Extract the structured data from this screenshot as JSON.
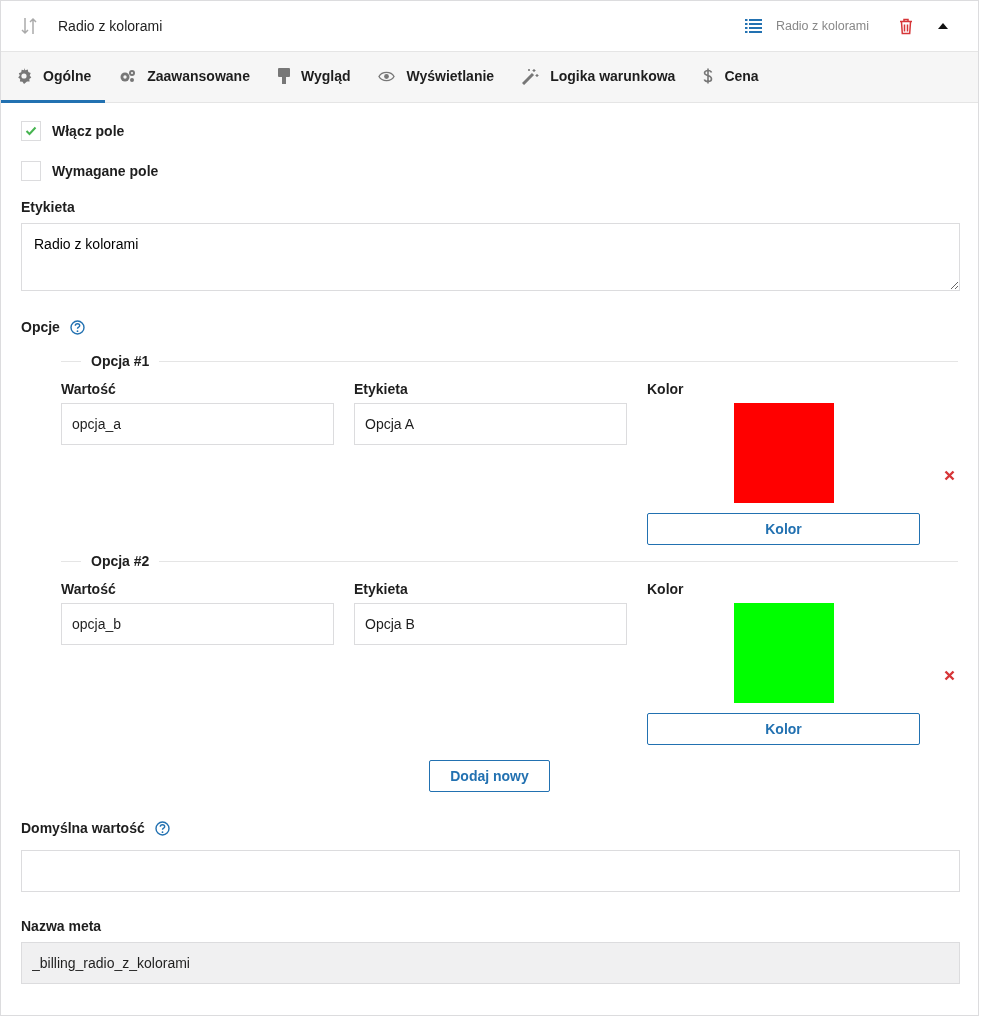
{
  "header": {
    "title": "Radio z kolorami",
    "type_label": "Radio z kolorami",
    "expanded": true
  },
  "tabs": [
    {
      "label": "Ogólne",
      "selected": true
    },
    {
      "label": "Zaawansowane",
      "selected": false
    },
    {
      "label": "Wygląd",
      "selected": false
    },
    {
      "label": "Wyświetlanie",
      "selected": false
    },
    {
      "label": "Logika warunkowa",
      "selected": false
    },
    {
      "label": "Cena",
      "selected": false
    }
  ],
  "checkboxes": [
    {
      "label": "Włącz pole",
      "checked": true
    },
    {
      "label": "Wymagane pole",
      "checked": false
    }
  ],
  "label_field": {
    "label": "Etykieta",
    "value": "Radio z kolorami"
  },
  "options": {
    "label": "Opcje",
    "items": [
      {
        "legend": "Opcja #1",
        "value_label": "Wartość",
        "value": "opcja_a",
        "label_label": "Etykieta",
        "label": "Opcja A",
        "color_label": "Kolor",
        "color": "#ff0000",
        "color_button": "Kolor"
      },
      {
        "legend": "Opcja #2",
        "value_label": "Wartość",
        "value": "opcja_b",
        "label_label": "Etykieta",
        "label": "Opcja B",
        "color_label": "Kolor",
        "color": "#00ff00",
        "color_button": "Kolor"
      }
    ],
    "add_button": "Dodaj nowy"
  },
  "default_field": {
    "label": "Domyślna wartość"
  },
  "meta_field": {
    "label": "Nazwa meta",
    "value": "_billing_radio_z_kolorami",
    "disabled": true
  }
}
